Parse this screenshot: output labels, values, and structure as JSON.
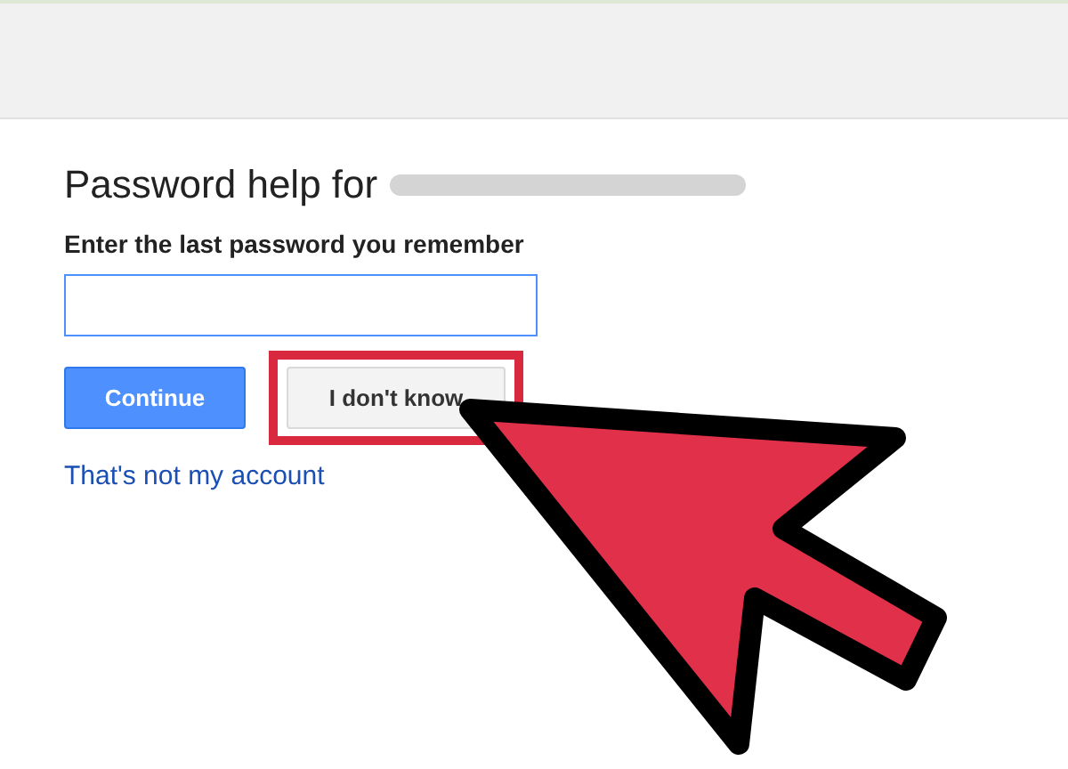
{
  "heading": {
    "text": "Password help for"
  },
  "prompt": "Enter the last password you remember",
  "buttons": [
    {
      "label": "Continue",
      "kind": "primary",
      "highlighted": false
    },
    {
      "label": "I don't know",
      "kind": "secondary",
      "highlighted": true
    }
  ],
  "link": "That's not my account"
}
